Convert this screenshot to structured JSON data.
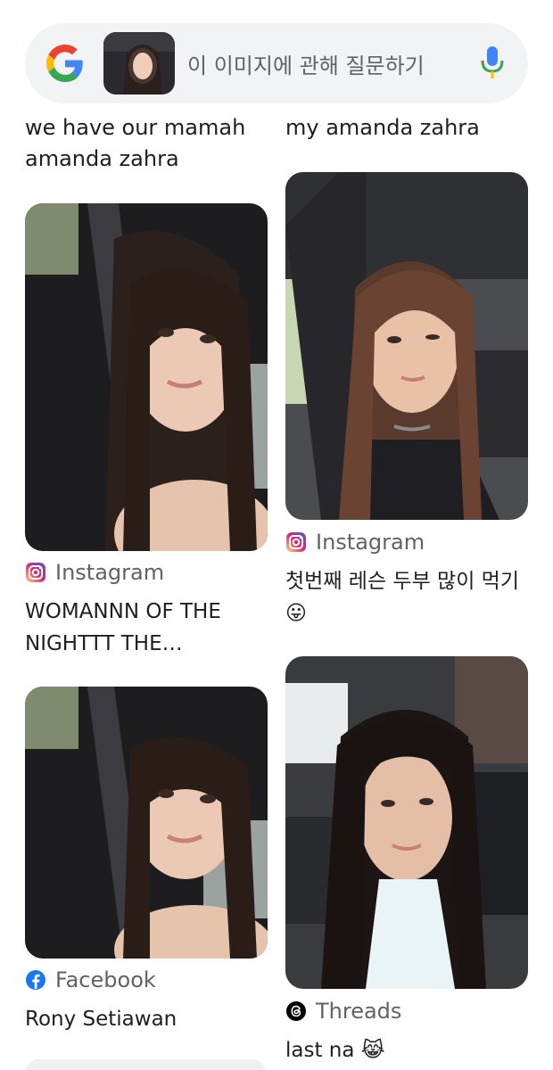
{
  "search": {
    "placeholder": "이 이미지에 관해 질문하기"
  },
  "results": [
    {
      "title": "we have our mamah amanda zahra"
    },
    {
      "title": "my amanda zahra"
    },
    {
      "source": "Instagram",
      "title": "WOMANNN OF THE NIGHTTT THE…"
    },
    {
      "source": "Instagram",
      "title": "첫번째 레슨 두부 많이 먹기😛"
    },
    {
      "source": "Facebook",
      "title": "Rony Setiawan"
    },
    {
      "source": "Threads",
      "title": "last na 😹"
    }
  ]
}
